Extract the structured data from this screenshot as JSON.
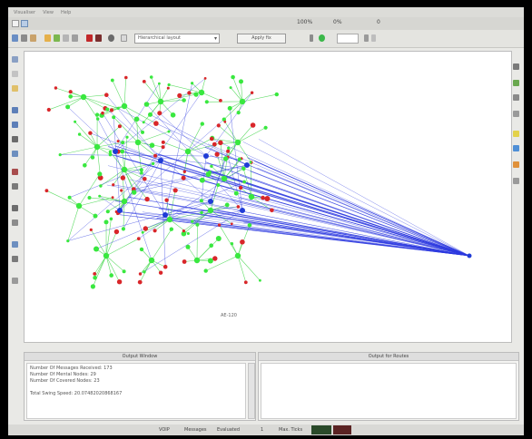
{
  "menu": [
    "Visualiser",
    "View",
    "Help"
  ],
  "window_status": [
    "100%",
    "0%",
    "0"
  ],
  "toolbar": {
    "layout_select": "Hierarchical layout",
    "action_button": "Apply fix",
    "zoom_field": ""
  },
  "canvas": {
    "caption": "AE-120"
  },
  "panels": {
    "left_title": "Output Window",
    "right_title": "Output for Routes",
    "output_lines": [
      "Number Of Messages Received: 173",
      "Number Of Mental Nodes: 29",
      "Number Of Covered Nodes: 23",
      "",
      "Total Swing Speed: 20.07482020868167"
    ]
  },
  "statusbar": [
    "VOIP",
    "Messages",
    "Evaluated",
    "1",
    "Max. Ticks"
  ],
  "colors": {
    "node_green": "#39e83f",
    "edge_green": "#5fdc66",
    "node_red": "#d9262a",
    "node_blue": "#1f3bd6",
    "edge_blue": "#2d3ae0"
  }
}
